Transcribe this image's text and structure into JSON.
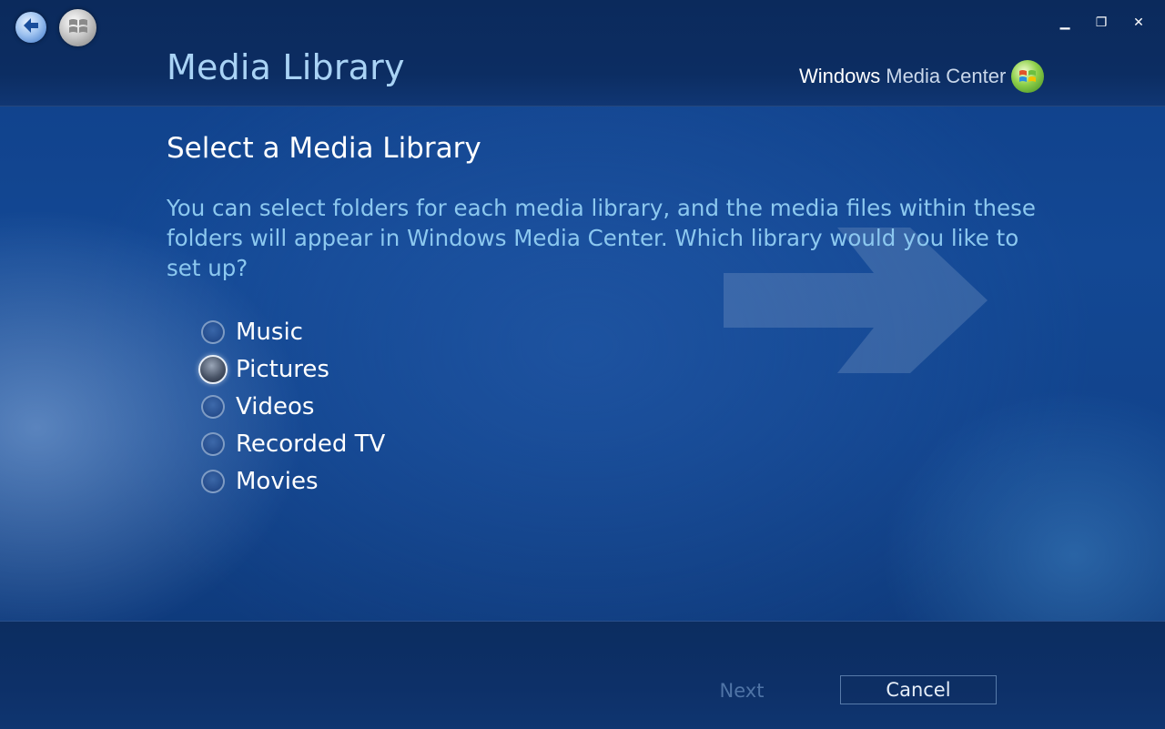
{
  "window": {
    "minimize_glyph": "▁",
    "restore_glyph": "❐",
    "close_glyph": "✕"
  },
  "header": {
    "title": "Media Library",
    "brand_windows": "Windows",
    "brand_media_center": "Media Center"
  },
  "main": {
    "heading": "Select a Media Library",
    "description": "You can select folders for each media library, and the media files within these folders will appear in Windows Media Center.  Which library would you like to set up?",
    "options": [
      {
        "label": "Music",
        "selected": false
      },
      {
        "label": "Pictures",
        "selected": true
      },
      {
        "label": "Videos",
        "selected": false
      },
      {
        "label": "Recorded TV",
        "selected": false
      },
      {
        "label": "Movies",
        "selected": false
      }
    ]
  },
  "footer": {
    "next_label": "Next",
    "cancel_label": "Cancel",
    "next_enabled": false
  },
  "colors": {
    "title": "#a9d3f5",
    "description": "#8cc8ef",
    "background": "#134894",
    "disabled_text": "#4f74a6"
  },
  "icons": {
    "back": "back-arrow-icon",
    "start": "windows-start-orb-icon",
    "brand": "windows-logo-icon"
  }
}
